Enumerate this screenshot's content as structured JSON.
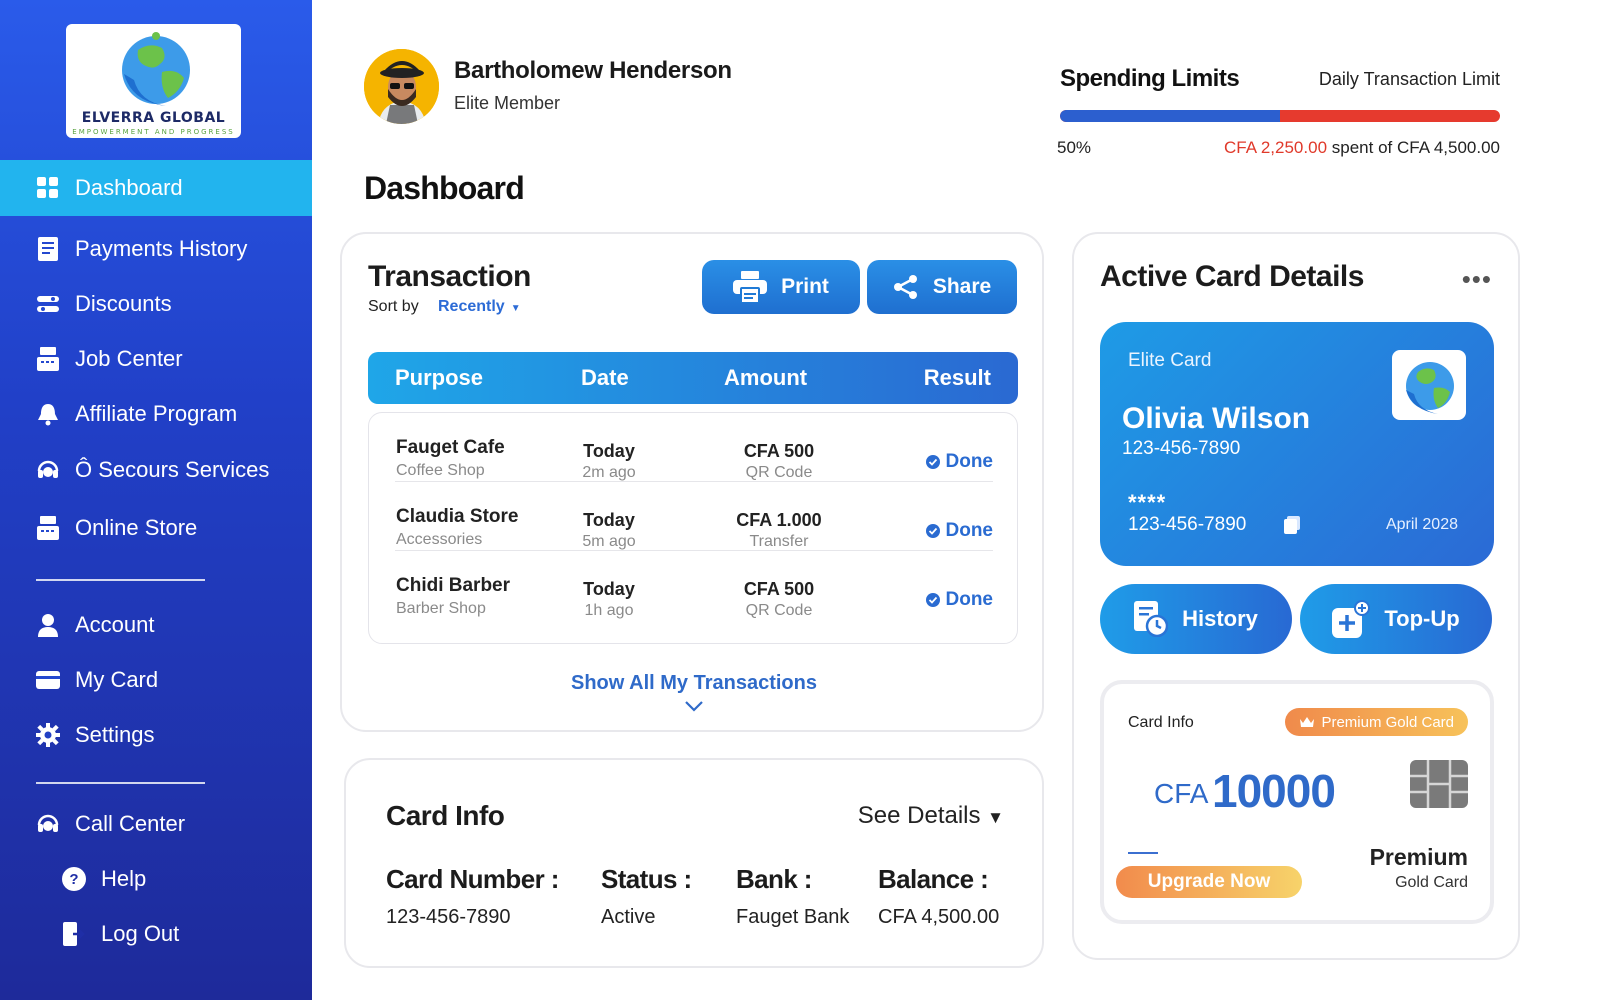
{
  "brand": {
    "name": "ELVERRA GLOBAL",
    "tagline": "EMPOWERMENT AND PROGRESS"
  },
  "sidebar": {
    "items": [
      {
        "label": "Dashboard",
        "icon": "grid-icon",
        "active": true
      },
      {
        "label": "Payments History",
        "icon": "receipt-icon"
      },
      {
        "label": "Discounts",
        "icon": "toggles-icon"
      },
      {
        "label": "Job Center",
        "icon": "register-icon"
      },
      {
        "label": "Affiliate Program",
        "icon": "bell-icon"
      },
      {
        "label": "Ô Secours Services",
        "icon": "headset-icon"
      },
      {
        "label": "Online Store",
        "icon": "register-icon"
      }
    ],
    "account_items": [
      {
        "label": "Account",
        "icon": "user-icon"
      },
      {
        "label": "My Card",
        "icon": "card-icon"
      },
      {
        "label": "Settings",
        "icon": "gear-icon"
      }
    ],
    "support_items": [
      {
        "label": "Call Center",
        "icon": "headset-icon"
      },
      {
        "label": "Help",
        "icon": "help-icon"
      },
      {
        "label": "Log Out",
        "icon": "logout-icon"
      }
    ]
  },
  "user": {
    "name": "Bartholomew Henderson",
    "tier": "Elite Member"
  },
  "page_title": "Dashboard",
  "spending": {
    "title": "Spending Limits",
    "subtitle": "Daily Transaction Limit",
    "percent_label": "50%",
    "percent": 0.5,
    "spent": "CFA 2,250.00",
    "spent_suffix": " spent of CFA 4,500.00"
  },
  "transactions": {
    "title": "Transaction",
    "sort_label": "Sort by",
    "sort_value": "Recently",
    "print_label": "Print",
    "share_label": "Share",
    "columns": [
      "Purpose",
      "Date",
      "Amount",
      "Result"
    ],
    "rows": [
      {
        "name": "Fauget Cafe",
        "category": "Coffee Shop",
        "day": "Today",
        "ago": "2m ago",
        "amount": "CFA 500",
        "method": "QR Code",
        "result": "Done"
      },
      {
        "name": "Claudia Store",
        "category": "Accessories",
        "day": "Today",
        "ago": "5m ago",
        "amount": "CFA 1.000",
        "method": "Transfer",
        "result": "Done"
      },
      {
        "name": "Chidi Barber",
        "category": "Barber Shop",
        "day": "Today",
        "ago": "1h ago",
        "amount": "CFA 500",
        "method": "QR Code",
        "result": "Done"
      }
    ],
    "show_all": "Show All My Transactions"
  },
  "card_info": {
    "title": "Card Info",
    "see_details": "See Details",
    "fields": [
      {
        "label": "Card Number :",
        "value": "123-456-7890"
      },
      {
        "label": "Status :",
        "value": "Active"
      },
      {
        "label": "Bank :",
        "value": "Fauget Bank"
      },
      {
        "label": "Balance :",
        "value": "CFA 4,500.00"
      }
    ]
  },
  "active_card": {
    "title": "Active Card Details",
    "more": "•••",
    "card": {
      "tier": "Elite Card",
      "holder": "Olivia Wilson",
      "phone": "123-456-7890",
      "stars": "****",
      "number": "123-456-7890",
      "expiry": "April 2028"
    },
    "history_label": "History",
    "topup_label": "Top-Up",
    "info": {
      "label": "Card Info",
      "badge": "Premium Gold Card",
      "currency": "CFA",
      "value": "10000",
      "upgrade": "Upgrade Now",
      "premium": "Premium",
      "premium_sub": "Gold Card"
    }
  },
  "colors": {
    "sidebar_top": "#2a5bea",
    "sidebar_bottom": "#1e2a9a",
    "active_nav": "#22b4ee",
    "accent_blue": "#2a6bd1",
    "limit_red": "#e63a2e",
    "gold": "#f28b4c"
  }
}
